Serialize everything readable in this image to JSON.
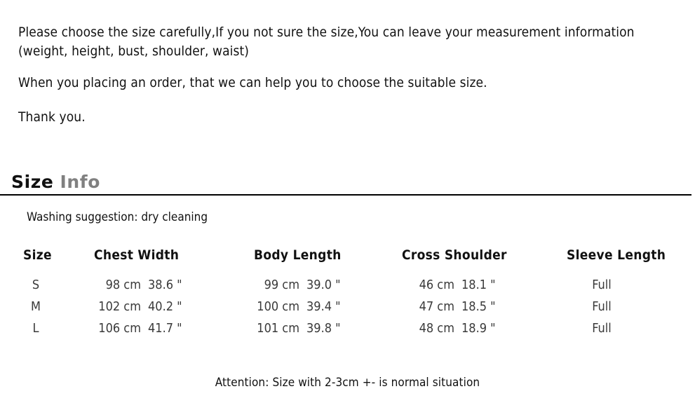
{
  "intro": {
    "paragraph_1": "Please choose the size carefully,If you not sure the size,You can leave your measurement information (weight, height, bust, shoulder, waist)",
    "paragraph_2": "When you placing an order, that we can help you to choose the suitable size.",
    "paragraph_3": "Thank you."
  },
  "heading": {
    "word_dark": "Size",
    "word_gray": "Info",
    "dark_color": "#111111",
    "gray_color": "#808080"
  },
  "washing_note": "Washing suggestion: dry cleaning",
  "table": {
    "headers": {
      "size": "Size",
      "chest_width": "Chest Width",
      "body_length": "Body Length",
      "cross_shoulder": "Cross Shoulder",
      "sleeve_length": "Sleeve Length"
    },
    "rows": [
      {
        "size": "S",
        "chest_cm": "98 cm",
        "chest_in": "38.6 \"",
        "body_cm": "99 cm",
        "body_in": "39.0 \"",
        "shoulder_cm": "46 cm",
        "shoulder_in": "18.1 \"",
        "sleeve": "Full"
      },
      {
        "size": "M",
        "chest_cm": "102 cm",
        "chest_in": "40.2 \"",
        "body_cm": "100 cm",
        "body_in": "39.4 \"",
        "shoulder_cm": "47 cm",
        "shoulder_in": "18.5 \"",
        "sleeve": "Full"
      },
      {
        "size": "L",
        "chest_cm": "106 cm",
        "chest_in": "41.7 \"",
        "body_cm": "101 cm",
        "body_in": "39.8 \"",
        "shoulder_cm": "48 cm",
        "shoulder_in": "18.9 \"",
        "sleeve": "Full"
      }
    ]
  },
  "attention": "Attention: Size with 2-3cm +- is normal situation"
}
